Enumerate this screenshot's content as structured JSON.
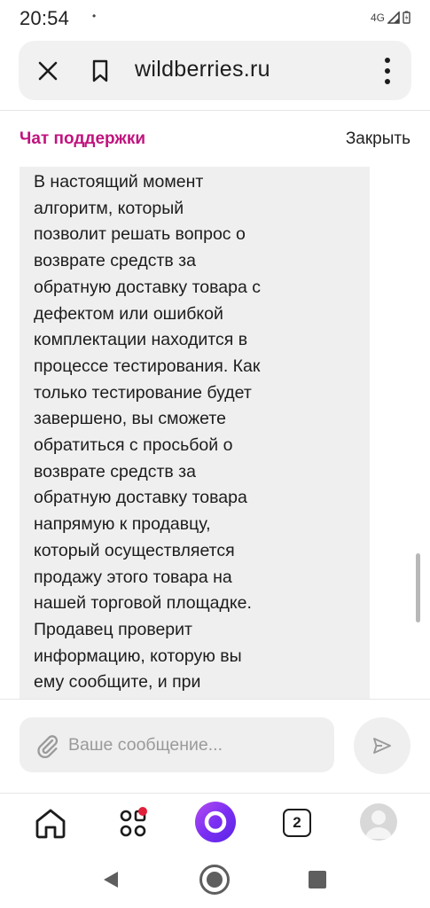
{
  "status_bar": {
    "time": "20:54",
    "dot": "•",
    "network": "4G"
  },
  "browser": {
    "url": "wildberries.ru"
  },
  "chat": {
    "title": "Чат поддержки",
    "close_label": "Закрыть",
    "message_lines": [
      "В настоящий момент",
      "алгоритм, который",
      "позволит решать вопрос о",
      "возврате средств за",
      "обратную доставку товара с",
      "дефектом или ошибкой",
      "комплектации находится в",
      "процессе тестирования. Как",
      "только тестирование будет",
      "завершено, вы сможете",
      "обратиться с просьбой о",
      "возврате средств за",
      "обратную доставку товара",
      "напрямую к продавцу,",
      "который осуществляется",
      "продажу этого товара на",
      "нашей торговой площадке.",
      "Продавец проверит",
      "информацию, которую вы",
      "ему сообщите, и при"
    ],
    "input_placeholder": "Ваше сообщение..."
  },
  "app_nav": {
    "tabs_count": "2"
  },
  "colors": {
    "accent": "#c1137e",
    "bubble": "#efefef",
    "badge": "#e0203a",
    "alice": "#7b2ff2"
  },
  "icons": {
    "browser_close": "close-icon",
    "browser_bookmark": "bookmark-icon",
    "browser_menu": "more-vertical-icon",
    "attach": "paperclip-icon",
    "send": "send-icon",
    "home": "home-icon",
    "catalog": "catalog-grid-icon",
    "alice": "alice-assistant-icon",
    "profile": "avatar-icon"
  }
}
